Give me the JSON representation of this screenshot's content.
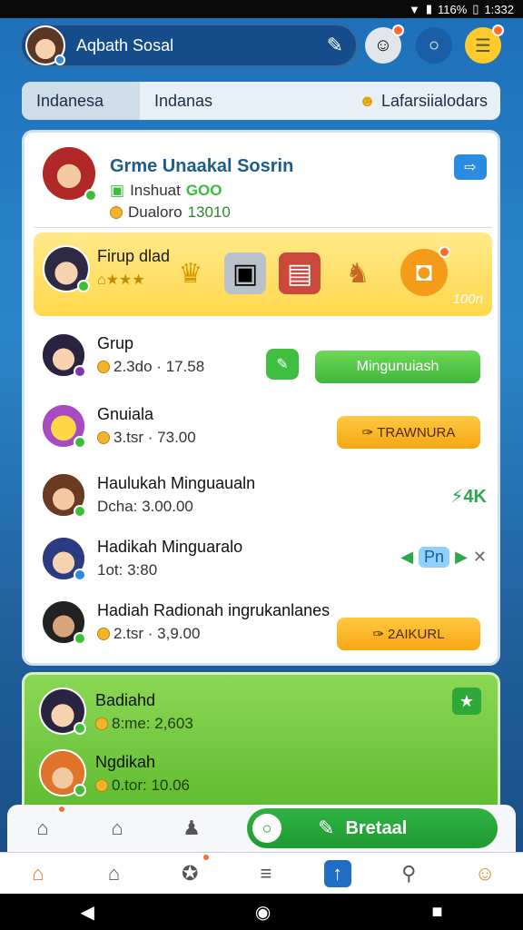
{
  "status": {
    "battery": "116%",
    "time": "1:332"
  },
  "topbar": {
    "title": "Aqbath Sosal"
  },
  "tabs": [
    "Indanesa",
    "Indanas"
  ],
  "tab_right": "Lafarsiialodars",
  "header": {
    "title": "Grme Unaakal Sosrin",
    "line1": "Inshuat",
    "line1_value": "GOO",
    "line2": "Dualoro",
    "line2_value": "13010"
  },
  "group": {
    "title": "Firup dlad",
    "counter": "100n"
  },
  "rows": [
    {
      "name": "Grup",
      "meta": "2.3do · 17.58",
      "button": "Mingunuiash"
    },
    {
      "name": "Gnuiala",
      "meta": "3.tsr · 73.00",
      "button": "TRAWNURA"
    },
    {
      "name": "Haulukah Minguaualn",
      "meta": "Dcha: 3.00.00",
      "value": "4K"
    },
    {
      "name": "Hadikah Minguaralo",
      "meta": "1ot: 3:80",
      "value": "Pn"
    },
    {
      "name": "Hadiah Radionah ingrukanlanes",
      "meta": "2.tsr · 3,9.00",
      "button": "2AIKURL"
    }
  ],
  "green": [
    {
      "name": "Badiahd",
      "meta": "8:me: 2,603"
    },
    {
      "name": "Ngdikah",
      "meta": "0.tor: 10.06"
    }
  ],
  "post_button": "Bretaal"
}
